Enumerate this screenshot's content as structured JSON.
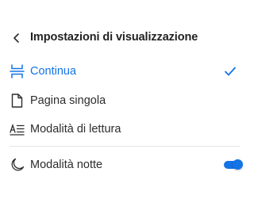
{
  "header": {
    "title": "Impostazioni di visualizzazione",
    "back_icon": "chevron-left-icon"
  },
  "view_modes": [
    {
      "label": "Continua",
      "icon": "continuous-scroll-icon",
      "selected": true
    },
    {
      "label": "Pagina singola",
      "icon": "single-page-icon",
      "selected": false
    },
    {
      "label": "Modalità di lettura",
      "icon": "reading-mode-icon",
      "selected": false
    }
  ],
  "night_mode": {
    "label": "Modalità notte",
    "icon": "moon-icon",
    "enabled": true
  },
  "colors": {
    "accent": "#1473e6",
    "text": "#2c2c2c",
    "divider": "#e4e4e4"
  }
}
